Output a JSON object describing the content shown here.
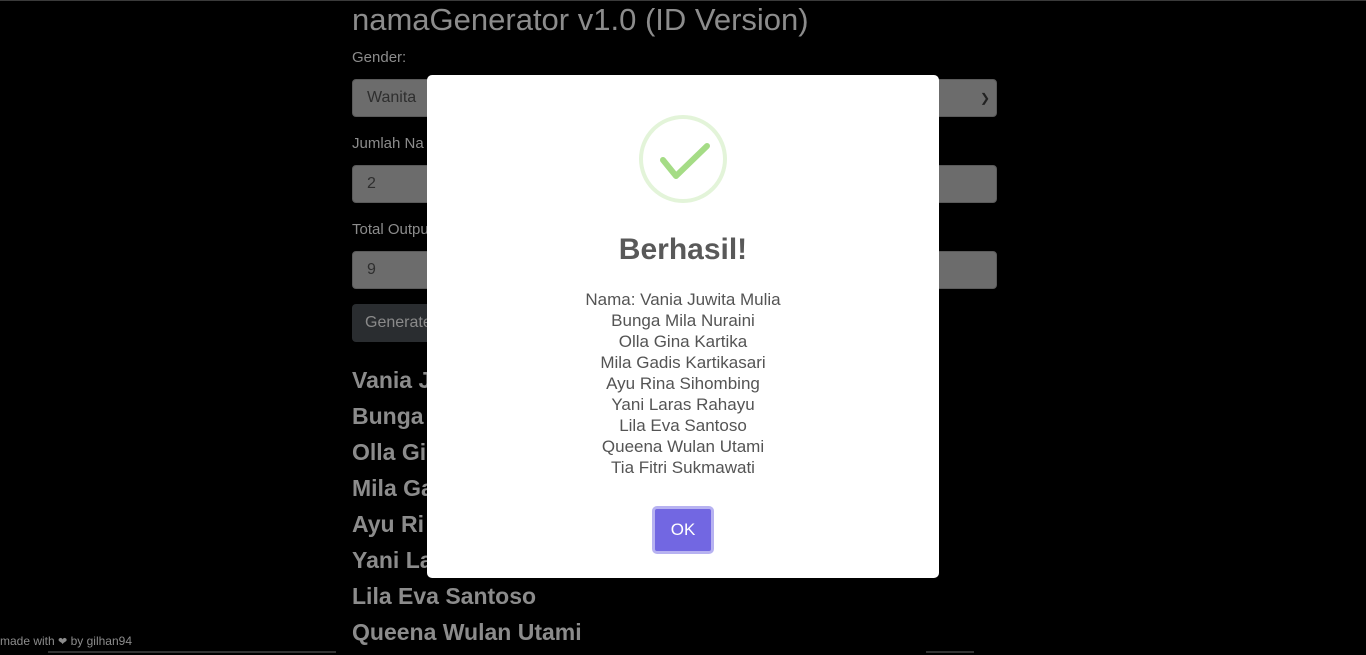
{
  "app": {
    "title": "namaGenerator v1.0 (ID Version)"
  },
  "form": {
    "gender_label": "Gender:",
    "gender_value": "Wanita",
    "jumlah_label": "Jumlah Na",
    "jumlah_value": "2",
    "total_label": "Total Outpu",
    "total_value": "9",
    "generate_label": "Generate"
  },
  "results": [
    "Vania J",
    "Bunga",
    "Olla Gi",
    "Mila Ga",
    "Ayu Ri",
    "Yani La",
    "Lila Eva Santoso",
    "Queena Wulan Utami"
  ],
  "footer": {
    "prefix": "made with",
    "suffix": "by gilhan94"
  },
  "modal": {
    "title": "Berhasil!",
    "lines": [
      "Nama: Vania Juwita Mulia",
      "Bunga Mila Nuraini",
      "Olla Gina Kartika",
      "Mila Gadis Kartikasari",
      "Ayu Rina Sihombing",
      "Yani Laras Rahayu",
      "Lila Eva Santoso",
      "Queena Wulan Utami",
      "Tia Fitri Sukmawati"
    ],
    "ok_label": "OK",
    "icon": "checkmark-icon",
    "accent": "#7267e2",
    "success_color": "#a5dc86"
  }
}
